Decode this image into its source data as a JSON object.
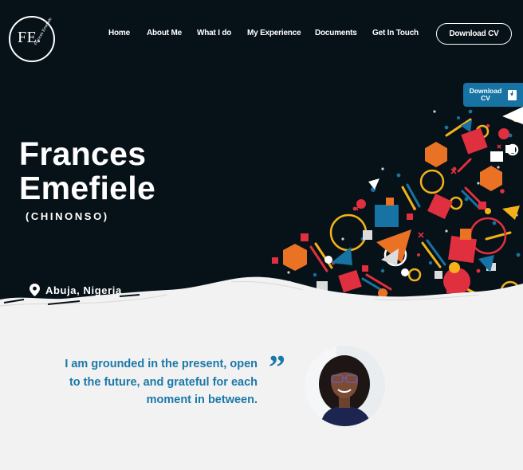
{
  "logo": {
    "mark": "FE.",
    "subtitle": "Frances Emefiele"
  },
  "nav": {
    "items": [
      {
        "label": "Home"
      },
      {
        "label": "About Me"
      },
      {
        "label": "What I do"
      },
      {
        "label": "My Experience"
      },
      {
        "label": "Documents"
      },
      {
        "label": "Get In Touch"
      }
    ],
    "cta_label": "Download CV"
  },
  "floating_cta": {
    "label": "Download CV",
    "icon": "download-file-icon"
  },
  "hero": {
    "first_name": "Frances",
    "last_name": "Emefiele",
    "nickname": "(CHINONSO)",
    "location": "Abuja, Nigeria",
    "location_icon": "map-pin-icon"
  },
  "quote": {
    "text": "I am grounded in the present, open to the future, and grateful for each moment in between.",
    "mark": "”"
  },
  "colors": {
    "hero_bg": "#071118",
    "accent_blue": "#1a78a8",
    "page_bg": "#f2f2f2"
  }
}
